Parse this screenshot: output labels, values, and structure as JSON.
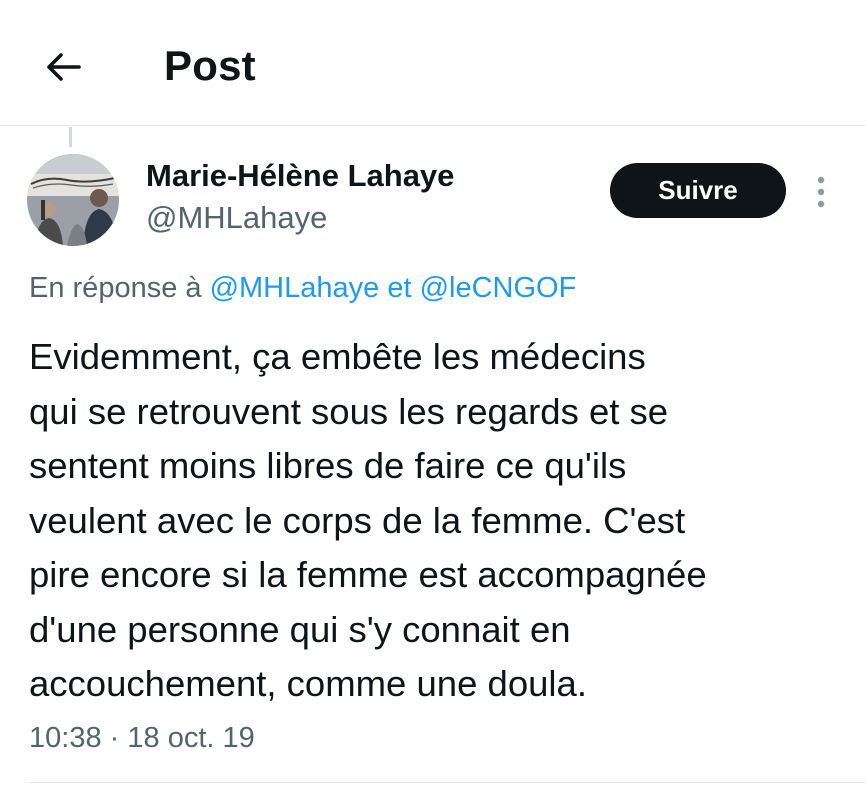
{
  "header": {
    "back_icon": "arrow-left-icon",
    "title": "Post"
  },
  "author": {
    "avatar_icon": "profile-photo",
    "display_name": "Marie-Hélène Lahaye",
    "handle": "@MHLahaye",
    "follow_label": "Suivre",
    "more_icon": "more-vertical-icon"
  },
  "reply": {
    "prefix": "En réponse à",
    "mention_1": "@MHLahaye",
    "conjunction": "et",
    "mention_2": "@leCNGOF"
  },
  "post": {
    "text_lines": [
      "Evidemment, ça embête les médecins",
      "qui se retrouvent sous les regards et se",
      "sentent moins libres de faire ce qu'ils",
      "veulent avec le corps de la femme. C'est",
      "pire encore si la femme est accompagnée",
      "d'une personne qui s'y connait en",
      "accouchement, comme une doula."
    ],
    "time": "10:38",
    "separator": "·",
    "date": "18 oct. 19"
  },
  "colors": {
    "text": "#0f1419",
    "secondary": "#536471",
    "link": "#1d9bf0",
    "button_bg": "#0f1419",
    "divider": "#e6e9ec"
  }
}
